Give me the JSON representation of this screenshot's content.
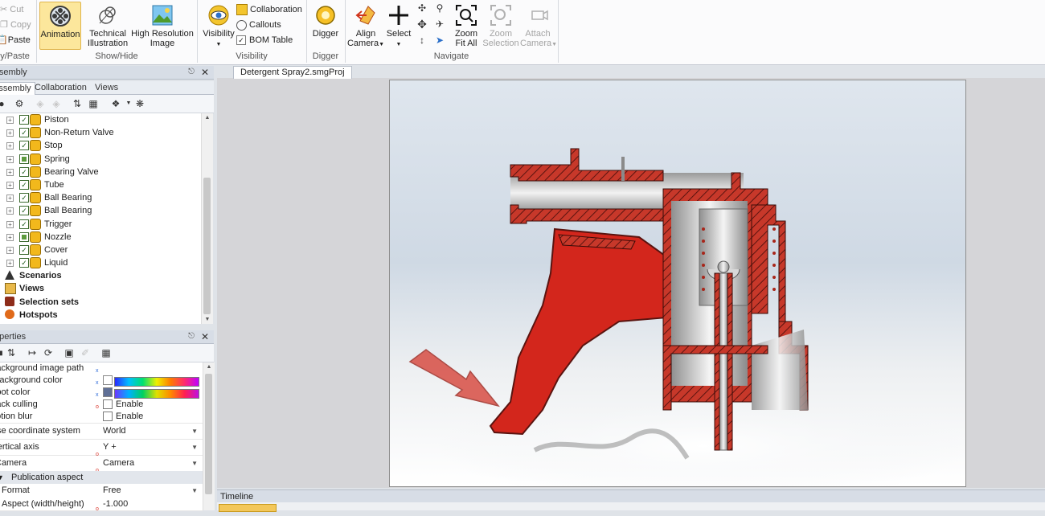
{
  "ribbon": {
    "clipboard": {
      "cut": "Cut",
      "copy": "Copy",
      "paste": "Paste",
      "group": "Copy/Paste"
    },
    "showhide": {
      "animation": "Animation",
      "technical": "Technical Illustration",
      "highres": "High Resolution Image",
      "group": "Show/Hide"
    },
    "visibility": {
      "visibility": "Visibility",
      "collaboration": "Collaboration",
      "callouts": "Callouts",
      "bom_table": "BOM Table",
      "group": "Visibility"
    },
    "digger": {
      "digger": "Digger",
      "group": "Digger"
    },
    "navigate": {
      "align_camera": "Align Camera",
      "select": "Select",
      "zoom_fit_all": "Zoom Fit All",
      "zoom_selection": "Zoom Selection",
      "attach_camera": "Attach Camera",
      "group": "Navigate"
    }
  },
  "assembly": {
    "title": "Assembly",
    "tabs": [
      "Assembly",
      "Collaboration",
      "Views"
    ],
    "items": [
      "Piston",
      "Non-Return Valve",
      "Stop",
      "Spring",
      "Bearing Valve",
      "Tube",
      "Ball Bearing",
      "Ball Bearing",
      "Trigger",
      "Nozzle",
      "Cover",
      "Liquid"
    ],
    "sections": [
      "Scenarios",
      "Views",
      "Selection sets",
      "Hotspots"
    ]
  },
  "properties": {
    "title": "Properties",
    "rows": [
      {
        "key": "Background image path",
        "value": ""
      },
      {
        "key": "Background color",
        "value": ""
      },
      {
        "key": "Spot color",
        "value": ""
      },
      {
        "key": "Back culling",
        "value": "Enable"
      },
      {
        "key": "Motion blur",
        "value": "Enable"
      },
      {
        "key": "Use coordinate system",
        "value": "World"
      },
      {
        "key": "Vertical axis",
        "value": "Y +"
      },
      {
        "key": "Camera",
        "value": "Camera"
      }
    ],
    "category": "Publication aspect",
    "rows2": [
      {
        "key": "Format",
        "value": "Free"
      },
      {
        "key": "Aspect (width/height)",
        "value": "-1.000"
      }
    ]
  },
  "document": {
    "tab": "Detergent Spray2.smgProj"
  },
  "timeline": {
    "title": "Timeline"
  }
}
